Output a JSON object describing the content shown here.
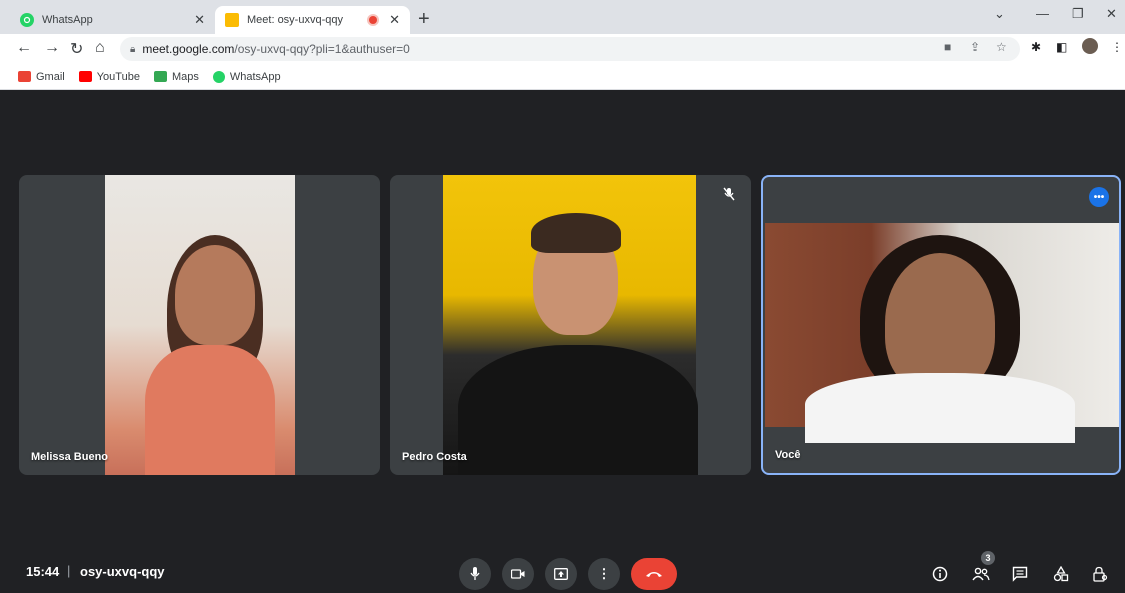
{
  "browser": {
    "tabs": [
      {
        "title": "WhatsApp",
        "icon": "whatsapp-icon"
      },
      {
        "title": "Meet: osy-uxvq-qqy",
        "icon": "google-meet-icon",
        "recording": true
      }
    ],
    "url_host": "meet.google.com",
    "url_rest": "/osy-uxvq-qqy?pli=1&authuser=0",
    "bookmarks": [
      {
        "label": "Gmail",
        "color": "#ea4335"
      },
      {
        "label": "YouTube",
        "color": "#ff0000"
      },
      {
        "label": "Maps",
        "color": "#34a853"
      },
      {
        "label": "WhatsApp",
        "color": "#25d366"
      }
    ]
  },
  "meet": {
    "participants": [
      {
        "name": "Melissa Bueno"
      },
      {
        "name": "Pedro Costa",
        "muted": true
      },
      {
        "name": "Você",
        "self": true
      }
    ],
    "time": "15:44",
    "code": "osy-uxvq-qqy",
    "people_count": "3",
    "colors": {
      "background": "#202124",
      "tile": "#3c4043",
      "end_call": "#ea4335",
      "accent": "#8ab4f8"
    }
  }
}
